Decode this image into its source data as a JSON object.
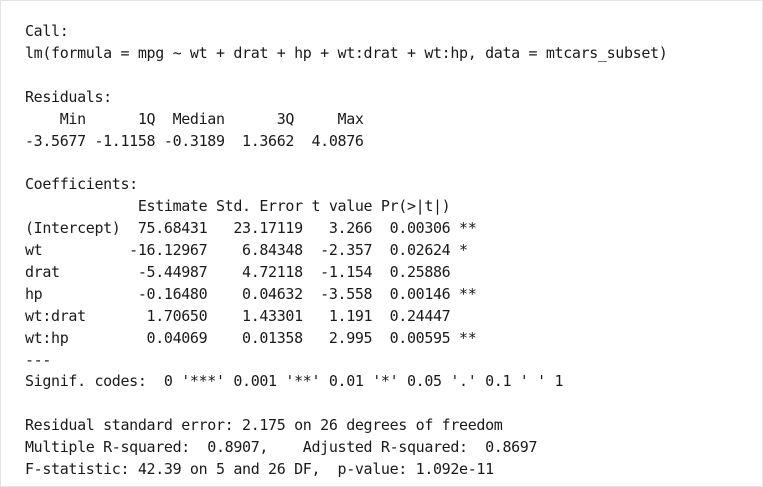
{
  "lines": [
    "Call:",
    "lm(formula = mpg ~ wt + drat + hp + wt:drat + wt:hp, data = mtcars_subset)",
    "",
    "Residuals:",
    "    Min      1Q  Median      3Q     Max ",
    "-3.5677 -1.1158 -0.3189  1.3662  4.0876 ",
    "",
    "Coefficients:",
    "             Estimate Std. Error t value Pr(>|t|)   ",
    "(Intercept)  75.68431   23.17119   3.266  0.00306 **",
    "wt          -16.12967    6.84348  -2.357  0.02624 * ",
    "drat         -5.44987    4.72118  -1.154  0.25886   ",
    "hp           -0.16480    0.04632  -3.558  0.00146 **",
    "wt:drat       1.70650    1.43301   1.191  0.24447   ",
    "wt:hp         0.04069    0.01358   2.995  0.00595 **",
    "---",
    "Signif. codes:  0 '***' 0.001 '**' 0.01 '*' 0.05 '.' 0.1 ' ' 1",
    "",
    "Residual standard error: 2.175 on 26 degrees of freedom",
    "Multiple R-squared:  0.8907,\tAdjusted R-squared:  0.8697 ",
    "F-statistic: 42.39 on 5 and 26 DF,  p-value: 1.092e-11"
  ]
}
